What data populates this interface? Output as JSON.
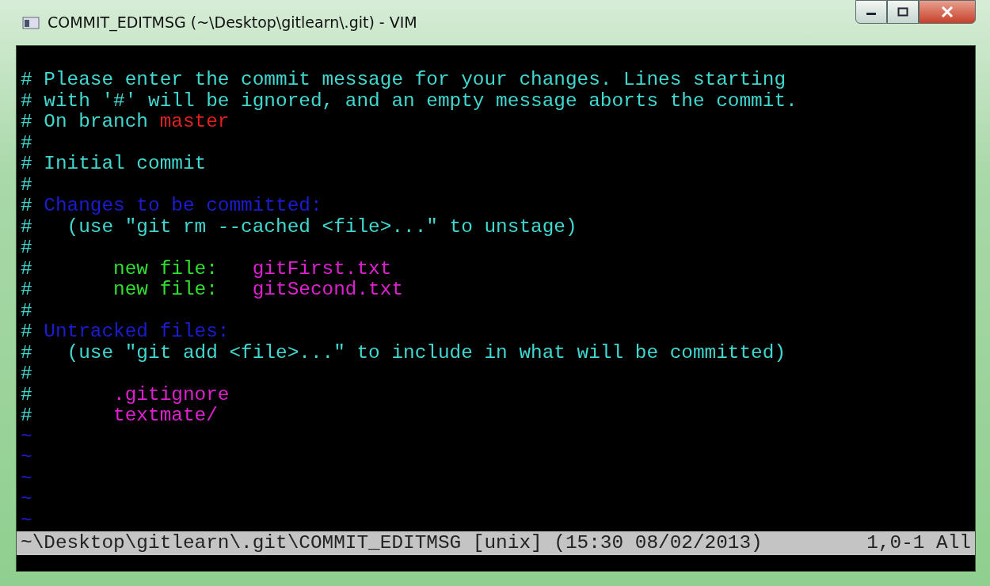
{
  "window": {
    "title": "COMMIT_EDITMSG (~\\Desktop\\gitlearn\\.git) - VIM"
  },
  "buffer": {
    "lines": [
      {
        "segments": [
          {
            "kind": "comment",
            "text": "# Please enter the commit message for your changes. Lines starting"
          }
        ]
      },
      {
        "segments": [
          {
            "kind": "comment",
            "text": "# with '#' will be ignored, and an empty message aborts the commit."
          }
        ]
      },
      {
        "segments": [
          {
            "kind": "comment",
            "text": "# On branch"
          },
          {
            "kind": "branch",
            "text": "master"
          }
        ]
      },
      {
        "segments": [
          {
            "kind": "comment",
            "text": "#"
          }
        ]
      },
      {
        "segments": [
          {
            "kind": "comment",
            "text": "# Initial commit"
          }
        ]
      },
      {
        "segments": [
          {
            "kind": "comment",
            "text": "#"
          }
        ]
      },
      {
        "segments": [
          {
            "kind": "comment",
            "text": "#"
          },
          {
            "kind": "heading",
            "text": "Changes to be committed:"
          }
        ]
      },
      {
        "segments": [
          {
            "kind": "comment",
            "text": "#   (use \"git rm --cached <file>...\" to unstage)"
          }
        ]
      },
      {
        "segments": [
          {
            "kind": "comment",
            "text": "#"
          }
        ]
      },
      {
        "segments": [
          {
            "kind": "comment",
            "text": "#"
          },
          {
            "kind": "status",
            "text": "new file:"
          },
          {
            "kind": "file",
            "text": "gitFirst.txt"
          }
        ]
      },
      {
        "segments": [
          {
            "kind": "comment",
            "text": "#"
          },
          {
            "kind": "status",
            "text": "new file:"
          },
          {
            "kind": "file",
            "text": "gitSecond.txt"
          }
        ]
      },
      {
        "segments": [
          {
            "kind": "comment",
            "text": "#"
          }
        ]
      },
      {
        "segments": [
          {
            "kind": "comment",
            "text": "#"
          },
          {
            "kind": "heading",
            "text": "Untracked files:"
          }
        ]
      },
      {
        "segments": [
          {
            "kind": "comment",
            "text": "#   (use \"git add <file>...\" to include in what will be committed)"
          }
        ]
      },
      {
        "segments": [
          {
            "kind": "comment",
            "text": "#"
          }
        ]
      },
      {
        "segments": [
          {
            "kind": "comment",
            "text": "#"
          },
          {
            "kind": "file",
            "text": ".gitignore"
          }
        ]
      },
      {
        "segments": [
          {
            "kind": "comment",
            "text": "#"
          },
          {
            "kind": "file",
            "text": "textmate/"
          }
        ]
      }
    ],
    "empty_lines": [
      "~",
      "~",
      "~",
      "~",
      "~"
    ]
  },
  "status_bar": {
    "file_info": "~\\Desktop\\gitlearn\\.git\\COMMIT_EDITMSG [unix] (15:30 08/02/2013)",
    "position": "1,0-1 All"
  }
}
